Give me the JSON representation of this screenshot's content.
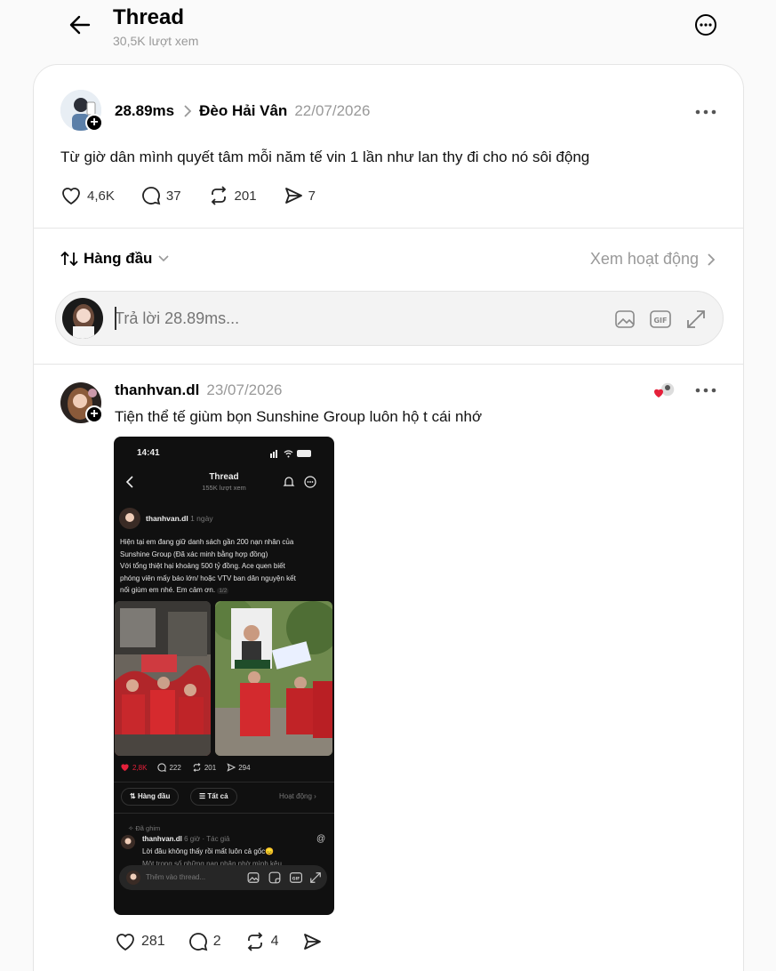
{
  "header": {
    "title": "Thread",
    "views": "30,5K lượt xem"
  },
  "post": {
    "username": "28.89ms",
    "group": "Đèo Hải Vân",
    "date": "22/07/2026",
    "text": "Từ giờ dân mình quyết tâm mỗi năm tế vin 1 lần như lan thy đi cho nó sôi động",
    "likes": "4,6K",
    "comments": "37",
    "reposts": "201",
    "shares": "7"
  },
  "sort": {
    "label": "Hàng đầu",
    "activity": "Xem hoạt động"
  },
  "reply": {
    "placeholder": "Trả lời 28.89ms..."
  },
  "comment": {
    "username": "thanhvan.dl",
    "date": "23/07/2026",
    "text": "Tiện thể tế giùm bọn Sunshine Group luôn hộ t cái nhớ",
    "likes": "281",
    "comments": "2",
    "reposts": "4"
  },
  "embedded": {
    "time": "14:41",
    "title": "Thread",
    "views": "155K lượt xem",
    "username": "thanhvan.dl",
    "ago": "1 ngày",
    "lines": [
      "Hiện tại em đang giữ danh sách gần 200 nạn nhân của",
      "Sunshine Group (Đã xác minh bằng hợp đồng)",
      "Với tổng thiệt hại khoảng 500 tỷ đồng. Ace quen biết",
      "phóng viên mấy báo lớn/ hoặc VTV ban dân nguyện kết",
      "nối giùm em nhé. Em cảm ơn."
    ],
    "page": "1/2",
    "likes": "2,8K",
    "comments": "222",
    "reposts": "201",
    "shares": "294",
    "sort": "Hàng đầu",
    "filter": "Tất cả",
    "activity": "Hoạt động",
    "pinned": "Đã ghim",
    "c_user": "thanhvan.dl",
    "c_meta": "6 giờ · Tác giả",
    "c_text1": "Lời đâu không thấy rồi mất luôn cả gốc😞",
    "c_text2": "Một trong số những nạn nhân nhờ mình kêu",
    "input": "Thêm vào thread..."
  }
}
